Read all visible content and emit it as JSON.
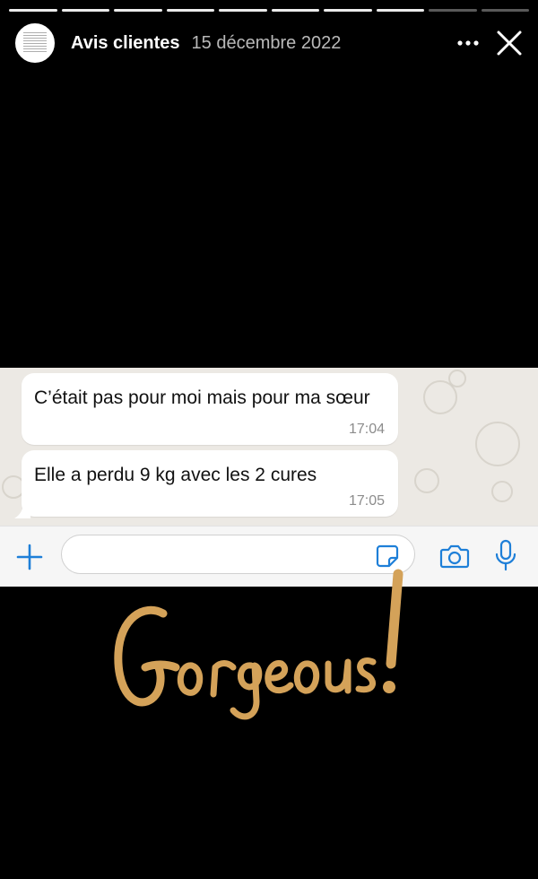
{
  "story": {
    "segments_total": 10,
    "segments_viewed": 8,
    "account_name": "Avis clientes",
    "date": "15 décembre 2022"
  },
  "chat": {
    "messages": [
      {
        "text": "C’était pas pour moi mais pour ma sœur",
        "time": "17:04"
      },
      {
        "text": "Elle a perdu 9 kg avec les 2 cures",
        "time": "17:05"
      }
    ],
    "input_value": "",
    "accent_color": "#1e7fd8",
    "background_color": "#ece9e4"
  },
  "sticker": {
    "text": "Gorgeous!",
    "color": "#d4a259"
  }
}
